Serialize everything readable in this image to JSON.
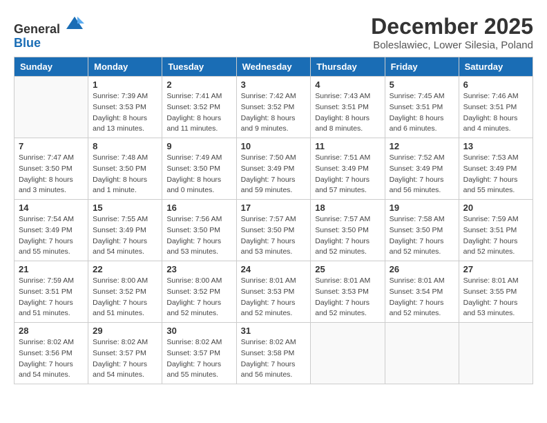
{
  "logo": {
    "general": "General",
    "blue": "Blue"
  },
  "title": "December 2025",
  "subtitle": "Boleslawiec, Lower Silesia, Poland",
  "headers": [
    "Sunday",
    "Monday",
    "Tuesday",
    "Wednesday",
    "Thursday",
    "Friday",
    "Saturday"
  ],
  "weeks": [
    [
      {
        "day": "",
        "info": ""
      },
      {
        "day": "1",
        "info": "Sunrise: 7:39 AM\nSunset: 3:53 PM\nDaylight: 8 hours\nand 13 minutes."
      },
      {
        "day": "2",
        "info": "Sunrise: 7:41 AM\nSunset: 3:52 PM\nDaylight: 8 hours\nand 11 minutes."
      },
      {
        "day": "3",
        "info": "Sunrise: 7:42 AM\nSunset: 3:52 PM\nDaylight: 8 hours\nand 9 minutes."
      },
      {
        "day": "4",
        "info": "Sunrise: 7:43 AM\nSunset: 3:51 PM\nDaylight: 8 hours\nand 8 minutes."
      },
      {
        "day": "5",
        "info": "Sunrise: 7:45 AM\nSunset: 3:51 PM\nDaylight: 8 hours\nand 6 minutes."
      },
      {
        "day": "6",
        "info": "Sunrise: 7:46 AM\nSunset: 3:51 PM\nDaylight: 8 hours\nand 4 minutes."
      }
    ],
    [
      {
        "day": "7",
        "info": "Sunrise: 7:47 AM\nSunset: 3:50 PM\nDaylight: 8 hours\nand 3 minutes."
      },
      {
        "day": "8",
        "info": "Sunrise: 7:48 AM\nSunset: 3:50 PM\nDaylight: 8 hours\nand 1 minute."
      },
      {
        "day": "9",
        "info": "Sunrise: 7:49 AM\nSunset: 3:50 PM\nDaylight: 8 hours\nand 0 minutes."
      },
      {
        "day": "10",
        "info": "Sunrise: 7:50 AM\nSunset: 3:49 PM\nDaylight: 7 hours\nand 59 minutes."
      },
      {
        "day": "11",
        "info": "Sunrise: 7:51 AM\nSunset: 3:49 PM\nDaylight: 7 hours\nand 57 minutes."
      },
      {
        "day": "12",
        "info": "Sunrise: 7:52 AM\nSunset: 3:49 PM\nDaylight: 7 hours\nand 56 minutes."
      },
      {
        "day": "13",
        "info": "Sunrise: 7:53 AM\nSunset: 3:49 PM\nDaylight: 7 hours\nand 55 minutes."
      }
    ],
    [
      {
        "day": "14",
        "info": "Sunrise: 7:54 AM\nSunset: 3:49 PM\nDaylight: 7 hours\nand 55 minutes."
      },
      {
        "day": "15",
        "info": "Sunrise: 7:55 AM\nSunset: 3:49 PM\nDaylight: 7 hours\nand 54 minutes."
      },
      {
        "day": "16",
        "info": "Sunrise: 7:56 AM\nSunset: 3:50 PM\nDaylight: 7 hours\nand 53 minutes."
      },
      {
        "day": "17",
        "info": "Sunrise: 7:57 AM\nSunset: 3:50 PM\nDaylight: 7 hours\nand 53 minutes."
      },
      {
        "day": "18",
        "info": "Sunrise: 7:57 AM\nSunset: 3:50 PM\nDaylight: 7 hours\nand 52 minutes."
      },
      {
        "day": "19",
        "info": "Sunrise: 7:58 AM\nSunset: 3:50 PM\nDaylight: 7 hours\nand 52 minutes."
      },
      {
        "day": "20",
        "info": "Sunrise: 7:59 AM\nSunset: 3:51 PM\nDaylight: 7 hours\nand 52 minutes."
      }
    ],
    [
      {
        "day": "21",
        "info": "Sunrise: 7:59 AM\nSunset: 3:51 PM\nDaylight: 7 hours\nand 51 minutes."
      },
      {
        "day": "22",
        "info": "Sunrise: 8:00 AM\nSunset: 3:52 PM\nDaylight: 7 hours\nand 51 minutes."
      },
      {
        "day": "23",
        "info": "Sunrise: 8:00 AM\nSunset: 3:52 PM\nDaylight: 7 hours\nand 52 minutes."
      },
      {
        "day": "24",
        "info": "Sunrise: 8:01 AM\nSunset: 3:53 PM\nDaylight: 7 hours\nand 52 minutes."
      },
      {
        "day": "25",
        "info": "Sunrise: 8:01 AM\nSunset: 3:53 PM\nDaylight: 7 hours\nand 52 minutes."
      },
      {
        "day": "26",
        "info": "Sunrise: 8:01 AM\nSunset: 3:54 PM\nDaylight: 7 hours\nand 52 minutes."
      },
      {
        "day": "27",
        "info": "Sunrise: 8:01 AM\nSunset: 3:55 PM\nDaylight: 7 hours\nand 53 minutes."
      }
    ],
    [
      {
        "day": "28",
        "info": "Sunrise: 8:02 AM\nSunset: 3:56 PM\nDaylight: 7 hours\nand 54 minutes."
      },
      {
        "day": "29",
        "info": "Sunrise: 8:02 AM\nSunset: 3:57 PM\nDaylight: 7 hours\nand 54 minutes."
      },
      {
        "day": "30",
        "info": "Sunrise: 8:02 AM\nSunset: 3:57 PM\nDaylight: 7 hours\nand 55 minutes."
      },
      {
        "day": "31",
        "info": "Sunrise: 8:02 AM\nSunset: 3:58 PM\nDaylight: 7 hours\nand 56 minutes."
      },
      {
        "day": "",
        "info": ""
      },
      {
        "day": "",
        "info": ""
      },
      {
        "day": "",
        "info": ""
      }
    ]
  ]
}
